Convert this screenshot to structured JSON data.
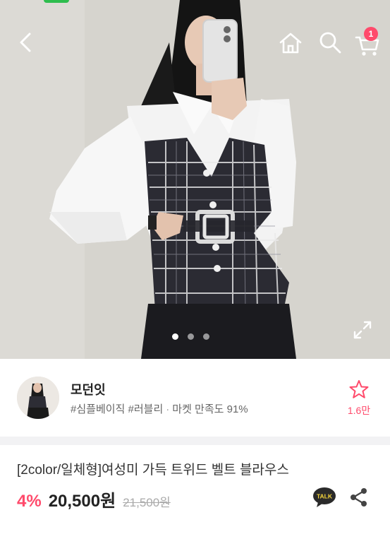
{
  "header": {
    "back": "back-icon",
    "home": "home-icon",
    "search": "search-icon",
    "cart": "cart-icon",
    "cart_badge": "1"
  },
  "gallery": {
    "slides": 3,
    "current": 1,
    "expand": "expand-icon"
  },
  "store": {
    "name": "모던잇",
    "tags": "#심플베이직 #러블리",
    "separator": "·",
    "satisfaction": "마켓 만족도 91%",
    "like_count": "1.6만"
  },
  "product": {
    "title": "[2color/일체형]여성미 가득 트위드 벨트 블라우스",
    "discount": "4%",
    "price": "20,500원",
    "original_price": "21,500원",
    "talk_label": "TALK"
  },
  "colors": {
    "accent": "#ff4a6b",
    "status_green": "#2ebd4e"
  }
}
